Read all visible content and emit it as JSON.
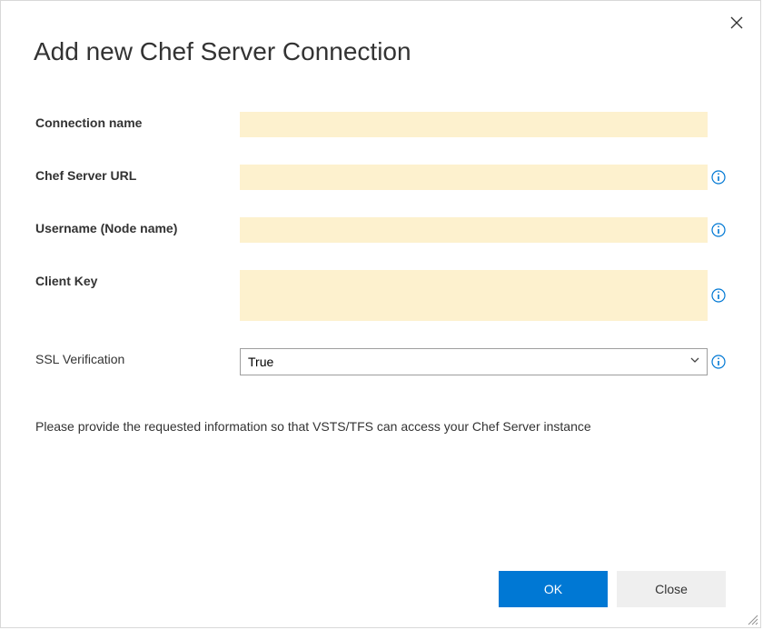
{
  "dialog": {
    "title": "Add new Chef Server Connection",
    "helper_text": "Please provide the requested information so that VSTS/TFS can access your Chef Server instance"
  },
  "fields": {
    "connection_name": {
      "label": "Connection name",
      "value": ""
    },
    "chef_server_url": {
      "label": "Chef Server URL",
      "value": ""
    },
    "username": {
      "label": "Username (Node name)",
      "value": ""
    },
    "client_key": {
      "label": "Client Key",
      "value": ""
    },
    "ssl_verification": {
      "label": "SSL Verification",
      "value": "True"
    }
  },
  "buttons": {
    "ok": "OK",
    "close": "Close"
  }
}
